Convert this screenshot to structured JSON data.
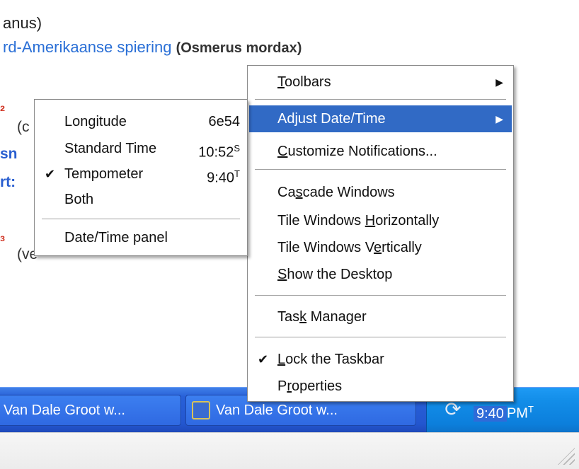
{
  "background": {
    "line1": "anus)",
    "line2_blue": "rd-Amerikaanse spiering",
    "line2_paren": "(Osmerus mordax)",
    "frag_c": "(c",
    "frag_sn": "sn",
    "frag_rt": "rt:",
    "frag_ve": "(ve"
  },
  "taskbar": {
    "buttons": [
      {
        "label": "Van Dale Groot w..."
      },
      {
        "label": "Van Dale Groot w..."
      }
    ],
    "clock": "9:40",
    "clock_suffix": "PM",
    "clock_sup": "T"
  },
  "context_menu": {
    "items": [
      {
        "label": "Toolbars",
        "ul": "T",
        "rest": "oolbars"
      },
      {
        "label": "Adjust Date/Time"
      },
      {
        "ul": "C",
        "rest": "ustomize Notifications..."
      },
      {
        "pre": "Ca",
        "ul": "s",
        "rest": "cade Windows"
      },
      {
        "label": "Tile Windows Horizontally",
        "pre": "Tile Windows ",
        "ul": "H",
        "rest": "orizontally"
      },
      {
        "pre": "Tile Windows V",
        "ul": "e",
        "rest": "rtically"
      },
      {
        "ul": "S",
        "rest": "how the Desktop"
      },
      {
        "pre": "Tas",
        "ul": "k",
        "rest": " Manager"
      },
      {
        "ul": "L",
        "rest": "ock the Taskbar"
      },
      {
        "pre": "P",
        "ul": "r",
        "rest": "operties"
      }
    ]
  },
  "date_submenu": {
    "items": [
      {
        "label": "Longitude",
        "value": "6e54",
        "sup": ""
      },
      {
        "label": "Standard Time",
        "value": "10:52",
        "sup": "S"
      },
      {
        "label": "Tempometer",
        "value": "9:40",
        "sup": "T"
      },
      {
        "label": "Both"
      },
      {
        "label": "Date/Time panel"
      }
    ]
  },
  "colors": {
    "selection": "#316ac5",
    "taskbar": "#2356cf",
    "tray": "#0c7fdc",
    "link_blue": "#2a6fd6"
  }
}
